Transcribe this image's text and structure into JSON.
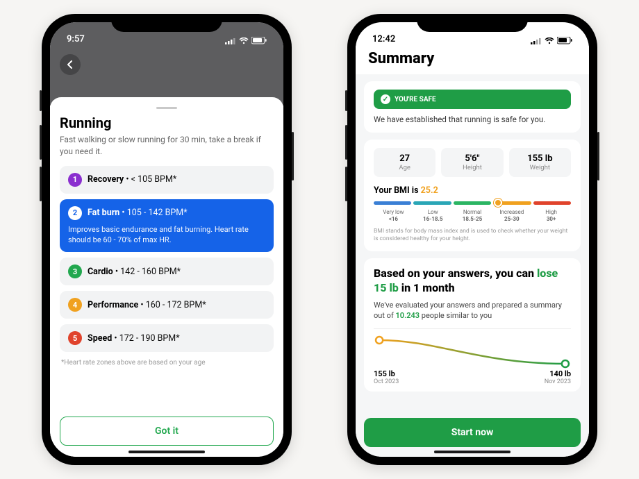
{
  "phone1": {
    "status_time": "9:57",
    "back_icon": "chevron-left",
    "sheet": {
      "title": "Running",
      "subtitle": "Fast walking or slow running for 30 min, take a break if you need it.",
      "zones": [
        {
          "num": "1",
          "name": "Recovery",
          "range": "< 105 BPM*",
          "color": "#8a2fcf",
          "active": false,
          "desc": ""
        },
        {
          "num": "2",
          "name": "Fat burn",
          "range": "105 - 142 BPM*",
          "color": "#1563e8",
          "active": true,
          "desc": "Improves basic endurance and fat burning. Heart rate should be 60 - 70% of max HR."
        },
        {
          "num": "3",
          "name": "Cardio",
          "range": "142 - 160 BPM*",
          "color": "#22a84f",
          "active": false,
          "desc": ""
        },
        {
          "num": "4",
          "name": "Performance",
          "range": "160 - 172 BPM*",
          "color": "#f0a11f",
          "active": false,
          "desc": ""
        },
        {
          "num": "5",
          "name": "Speed",
          "range": "172 - 190 BPM*",
          "color": "#e0432c",
          "active": false,
          "desc": ""
        }
      ],
      "footnote": "*Heart rate zones above are based on your age",
      "cta": "Got it"
    }
  },
  "phone2": {
    "status_time": "12:42",
    "title": "Summary",
    "safe": {
      "badge": "YOU'RE SAFE",
      "desc": "We have established that running is safe for you."
    },
    "stats": [
      {
        "val": "27",
        "lbl": "Age"
      },
      {
        "val": "5'6\"",
        "lbl": "Height"
      },
      {
        "val": "155 lb",
        "lbl": "Weight"
      }
    ],
    "bmi": {
      "prefix": "Your BMI is ",
      "value": "25.2",
      "segments": [
        {
          "name": "Very low",
          "range": "<16",
          "color": "#3a7fd5"
        },
        {
          "name": "Low",
          "range": "16-18.5",
          "color": "#2aa6b6"
        },
        {
          "name": "Normal",
          "range": "18.5-25",
          "color": "#2bb563"
        },
        {
          "name": "Increased",
          "range": "25-30",
          "color": "#f0a11f"
        },
        {
          "name": "High",
          "range": "30+",
          "color": "#e0432c"
        }
      ],
      "marker_pct": 63,
      "footnote": "BMI stands for body mass index and is used to check whether your weight is considered healthy for your height."
    },
    "answers": {
      "line1": "Based on your answers, you can ",
      "lose": "lose 15 lb",
      "line2": " in 1 month",
      "sub_a": "We've evaluated your answers and prepared a summary out of ",
      "people": "10.243",
      "sub_b": " people similar to you"
    },
    "chart_data": {
      "type": "line",
      "x": [
        "Oct 2023",
        "Nov 2023"
      ],
      "series": [
        {
          "name": "Weight",
          "values": [
            155,
            140
          ]
        }
      ],
      "ylabel": "lb",
      "start_color": "#f0a11f",
      "end_color": "#1f9d46"
    },
    "chart_labels": {
      "start_w": "155 lb",
      "start_d": "Oct 2023",
      "end_w": "140 lb",
      "end_d": "Nov 2023"
    },
    "cta": "Start now"
  }
}
